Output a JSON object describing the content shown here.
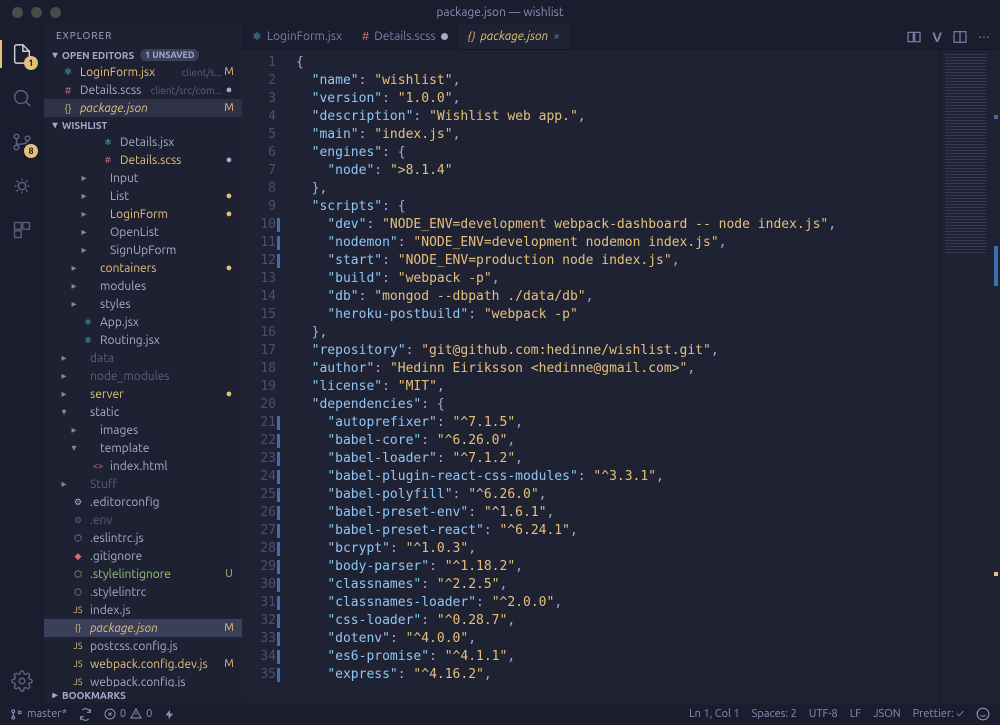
{
  "title": "package.json — wishlist",
  "explorerLabel": "EXPLORER",
  "openEditorsLabel": "OPEN EDITORS",
  "unsavedLabel": "1 UNSAVED",
  "projectLabel": "WISHLIST",
  "bookmarksLabel": "BOOKMARKS",
  "scmBadge": "8",
  "openEditors": [
    {
      "icon": "⚛",
      "iconColor": "#61dafb",
      "name": "LoginForm.jsx",
      "desc": "client/s...",
      "status": "M",
      "color": "yellow"
    },
    {
      "icon": "#",
      "iconColor": "#e06c75",
      "name": "Details.scss",
      "desc": "client/src/com...",
      "status": "●",
      "color": "",
      "dirty": true
    },
    {
      "icon": "{}",
      "iconColor": "#e5c07b",
      "name": "package.json",
      "desc": "",
      "status": "M",
      "color": "yellow",
      "active": true,
      "italic": true
    }
  ],
  "tree": [
    {
      "depth": 3,
      "chev": "",
      "icon": "⚛",
      "iconColor": "#61dafb",
      "label": "Details.jsx"
    },
    {
      "depth": 3,
      "chev": "",
      "icon": "#",
      "iconColor": "#e06c75",
      "label": "Details.scss",
      "status": "●",
      "statusClass": "dot",
      "color": "yellow"
    },
    {
      "depth": 2,
      "chev": "▸",
      "icon": "",
      "label": "Input"
    },
    {
      "depth": 2,
      "chev": "▸",
      "icon": "",
      "label": "List",
      "status": "●",
      "statusClass": "dot color-yellow"
    },
    {
      "depth": 2,
      "chev": "▸",
      "icon": "",
      "label": "LoginForm",
      "color": "yellow",
      "status": "●",
      "statusClass": "dot color-yellow"
    },
    {
      "depth": 2,
      "chev": "▸",
      "icon": "",
      "label": "OpenList"
    },
    {
      "depth": 2,
      "chev": "▸",
      "icon": "",
      "label": "SignUpForm"
    },
    {
      "depth": 1,
      "chev": "▸",
      "icon": "",
      "label": "containers",
      "color": "yellow",
      "status": "●",
      "statusClass": "dot color-yellow"
    },
    {
      "depth": 1,
      "chev": "▸",
      "icon": "",
      "label": "modules"
    },
    {
      "depth": 1,
      "chev": "▸",
      "icon": "",
      "label": "styles"
    },
    {
      "depth": 1,
      "chev": "",
      "icon": "⚛",
      "iconColor": "#61dafb",
      "label": "App.jsx"
    },
    {
      "depth": 1,
      "chev": "",
      "icon": "⚛",
      "iconColor": "#61dafb",
      "label": "Routing.jsx"
    },
    {
      "depth": 0,
      "chev": "▸",
      "icon": "",
      "label": "data",
      "color": "dim"
    },
    {
      "depth": 0,
      "chev": "▸",
      "icon": "",
      "label": "node_modules",
      "color": "dim"
    },
    {
      "depth": 0,
      "chev": "▸",
      "icon": "",
      "label": "server",
      "color": "yellow",
      "status": "●",
      "statusClass": "dot color-yellow"
    },
    {
      "depth": 0,
      "chev": "▾",
      "icon": "",
      "label": "static"
    },
    {
      "depth": 1,
      "chev": "▸",
      "icon": "",
      "label": "images"
    },
    {
      "depth": 1,
      "chev": "▾",
      "icon": "",
      "label": "template"
    },
    {
      "depth": 2,
      "chev": "",
      "icon": "<>",
      "iconColor": "#e06c75",
      "label": "index.html"
    },
    {
      "depth": 0,
      "chev": "▸",
      "icon": "",
      "label": "Stuff",
      "color": "dim"
    },
    {
      "depth": 0,
      "chev": "",
      "icon": "⚙",
      "iconColor": "#a6accd",
      "label": ".editorconfig"
    },
    {
      "depth": 0,
      "chev": "",
      "icon": "⚙",
      "iconColor": "#5a6080",
      "label": ".env",
      "color": "dim"
    },
    {
      "depth": 0,
      "chev": "",
      "icon": "⬡",
      "iconColor": "#c678dd",
      "label": ".eslintrc.js"
    },
    {
      "depth": 0,
      "chev": "",
      "icon": "◆",
      "iconColor": "#e06c75",
      "label": ".gitignore"
    },
    {
      "depth": 0,
      "chev": "",
      "icon": "⬡",
      "iconColor": "#98c379",
      "label": ".stylelintignore",
      "color": "green",
      "status": "U"
    },
    {
      "depth": 0,
      "chev": "",
      "icon": "⬡",
      "iconColor": "#56b6c2",
      "label": ".stylelintrc"
    },
    {
      "depth": 0,
      "chev": "",
      "icon": "JS",
      "iconColor": "#e5c07b",
      "label": "index.js"
    },
    {
      "depth": 0,
      "chev": "",
      "icon": "{}",
      "iconColor": "#e5c07b",
      "label": "package.json",
      "color": "yellow",
      "status": "M",
      "selected": true,
      "italic": true
    },
    {
      "depth": 0,
      "chev": "",
      "icon": "JS",
      "iconColor": "#e5c07b",
      "label": "postcss.config.js"
    },
    {
      "depth": 0,
      "chev": "",
      "icon": "JS",
      "iconColor": "#e5c07b",
      "label": "webpack.config.dev.js",
      "color": "yellow",
      "status": "M"
    },
    {
      "depth": 0,
      "chev": "",
      "icon": "JS",
      "iconColor": "#e5c07b",
      "label": "webpack.config.js"
    }
  ],
  "tabs": [
    {
      "icon": "⚛",
      "iconColor": "#61dafb",
      "label": "LoginForm.jsx",
      "dirty": false
    },
    {
      "icon": "#",
      "iconColor": "#e06c75",
      "label": "Details.scss",
      "dirty": true
    },
    {
      "icon": "{}",
      "iconColor": "#e5c07b",
      "label": "package.json",
      "active": true,
      "dirty": false
    }
  ],
  "tabActionV": "V",
  "code": [
    {
      "n": 1,
      "t": [
        [
          "punc",
          "{"
        ]
      ]
    },
    {
      "n": 2,
      "t": [
        [
          "punc",
          "  "
        ],
        [
          "key",
          "\"name\""
        ],
        [
          "op",
          ": "
        ],
        [
          "str",
          "\"wishlist\""
        ],
        [
          "punc",
          ","
        ]
      ]
    },
    {
      "n": 3,
      "t": [
        [
          "punc",
          "  "
        ],
        [
          "key",
          "\"version\""
        ],
        [
          "op",
          ": "
        ],
        [
          "str",
          "\"1.0.0\""
        ],
        [
          "punc",
          ","
        ]
      ]
    },
    {
      "n": 4,
      "t": [
        [
          "punc",
          "  "
        ],
        [
          "key",
          "\"description\""
        ],
        [
          "op",
          ": "
        ],
        [
          "str",
          "\"Wishlist web app.\""
        ],
        [
          "punc",
          ","
        ]
      ]
    },
    {
      "n": 5,
      "t": [
        [
          "punc",
          "  "
        ],
        [
          "key",
          "\"main\""
        ],
        [
          "op",
          ": "
        ],
        [
          "str",
          "\"index.js\""
        ],
        [
          "punc",
          ","
        ]
      ]
    },
    {
      "n": 6,
      "t": [
        [
          "punc",
          "  "
        ],
        [
          "key",
          "\"engines\""
        ],
        [
          "op",
          ": "
        ],
        [
          "punc",
          "{"
        ]
      ]
    },
    {
      "n": 7,
      "t": [
        [
          "punc",
          "    "
        ],
        [
          "key",
          "\"node\""
        ],
        [
          "op",
          ": "
        ],
        [
          "str",
          "\">8.1.4\""
        ]
      ]
    },
    {
      "n": 8,
      "t": [
        [
          "punc",
          "  },"
        ]
      ]
    },
    {
      "n": 9,
      "t": [
        [
          "punc",
          "  "
        ],
        [
          "key",
          "\"scripts\""
        ],
        [
          "op",
          ": "
        ],
        [
          "punc",
          "{"
        ]
      ]
    },
    {
      "n": 10,
      "mod": true,
      "t": [
        [
          "punc",
          "    "
        ],
        [
          "key",
          "\"dev\""
        ],
        [
          "op",
          ": "
        ],
        [
          "str",
          "\"NODE_ENV=development webpack-dashboard -- node index.js\""
        ],
        [
          "punc",
          ","
        ]
      ]
    },
    {
      "n": 11,
      "mod": true,
      "t": [
        [
          "punc",
          "    "
        ],
        [
          "key",
          "\"nodemon\""
        ],
        [
          "op",
          ": "
        ],
        [
          "str",
          "\"NODE_ENV=development nodemon index.js\""
        ],
        [
          "punc",
          ","
        ]
      ]
    },
    {
      "n": 12,
      "mod": true,
      "t": [
        [
          "punc",
          "    "
        ],
        [
          "key",
          "\"start\""
        ],
        [
          "op",
          ": "
        ],
        [
          "str",
          "\"NODE_ENV=production node index.js\""
        ],
        [
          "punc",
          ","
        ]
      ]
    },
    {
      "n": 13,
      "t": [
        [
          "punc",
          "    "
        ],
        [
          "key",
          "\"build\""
        ],
        [
          "op",
          ": "
        ],
        [
          "str",
          "\"webpack -p\""
        ],
        [
          "punc",
          ","
        ]
      ]
    },
    {
      "n": 14,
      "t": [
        [
          "punc",
          "    "
        ],
        [
          "key",
          "\"db\""
        ],
        [
          "op",
          ": "
        ],
        [
          "str",
          "\"mongod --dbpath ./data/db\""
        ],
        [
          "punc",
          ","
        ]
      ]
    },
    {
      "n": 15,
      "t": [
        [
          "punc",
          "    "
        ],
        [
          "key",
          "\"heroku-postbuild\""
        ],
        [
          "op",
          ": "
        ],
        [
          "str",
          "\"webpack -p\""
        ]
      ]
    },
    {
      "n": 16,
      "t": [
        [
          "punc",
          "  },"
        ]
      ]
    },
    {
      "n": 17,
      "t": [
        [
          "punc",
          "  "
        ],
        [
          "key",
          "\"repository\""
        ],
        [
          "op",
          ": "
        ],
        [
          "str",
          "\"git@github.com:hedinne/wishlist.git\""
        ],
        [
          "punc",
          ","
        ]
      ]
    },
    {
      "n": 18,
      "t": [
        [
          "punc",
          "  "
        ],
        [
          "key",
          "\"author\""
        ],
        [
          "op",
          ": "
        ],
        [
          "str",
          "\"Hedinn Eiriksson <hedinne@gmail.com>\""
        ],
        [
          "punc",
          ","
        ]
      ]
    },
    {
      "n": 19,
      "t": [
        [
          "punc",
          "  "
        ],
        [
          "key",
          "\"license\""
        ],
        [
          "op",
          ": "
        ],
        [
          "str",
          "\"MIT\""
        ],
        [
          "punc",
          ","
        ]
      ]
    },
    {
      "n": 20,
      "t": [
        [
          "punc",
          "  "
        ],
        [
          "key",
          "\"dependencies\""
        ],
        [
          "op",
          ": "
        ],
        [
          "punc",
          "{"
        ]
      ]
    },
    {
      "n": 21,
      "mod": true,
      "t": [
        [
          "punc",
          "    "
        ],
        [
          "key",
          "\"autoprefixer\""
        ],
        [
          "op",
          ": "
        ],
        [
          "str",
          "\"^7.1.5\""
        ],
        [
          "punc",
          ","
        ]
      ]
    },
    {
      "n": 22,
      "mod": true,
      "t": [
        [
          "punc",
          "    "
        ],
        [
          "key",
          "\"babel-core\""
        ],
        [
          "op",
          ": "
        ],
        [
          "str",
          "\"^6.26.0\""
        ],
        [
          "punc",
          ","
        ]
      ]
    },
    {
      "n": 23,
      "mod": true,
      "t": [
        [
          "punc",
          "    "
        ],
        [
          "key",
          "\"babel-loader\""
        ],
        [
          "op",
          ": "
        ],
        [
          "str",
          "\"^7.1.2\""
        ],
        [
          "punc",
          ","
        ]
      ]
    },
    {
      "n": 24,
      "mod": true,
      "t": [
        [
          "punc",
          "    "
        ],
        [
          "key",
          "\"babel-plugin-react-css-modules\""
        ],
        [
          "op",
          ": "
        ],
        [
          "str",
          "\"^3.3.1\""
        ],
        [
          "punc",
          ","
        ]
      ]
    },
    {
      "n": 25,
      "mod": true,
      "t": [
        [
          "punc",
          "    "
        ],
        [
          "key",
          "\"babel-polyfill\""
        ],
        [
          "op",
          ": "
        ],
        [
          "str",
          "\"^6.26.0\""
        ],
        [
          "punc",
          ","
        ]
      ]
    },
    {
      "n": 26,
      "mod": true,
      "t": [
        [
          "punc",
          "    "
        ],
        [
          "key",
          "\"babel-preset-env\""
        ],
        [
          "op",
          ": "
        ],
        [
          "str",
          "\"^1.6.1\""
        ],
        [
          "punc",
          ","
        ]
      ]
    },
    {
      "n": 27,
      "mod": true,
      "t": [
        [
          "punc",
          "    "
        ],
        [
          "key",
          "\"babel-preset-react\""
        ],
        [
          "op",
          ": "
        ],
        [
          "str",
          "\"^6.24.1\""
        ],
        [
          "punc",
          ","
        ]
      ]
    },
    {
      "n": 28,
      "mod": true,
      "t": [
        [
          "punc",
          "    "
        ],
        [
          "key",
          "\"bcrypt\""
        ],
        [
          "op",
          ": "
        ],
        [
          "str",
          "\"^1.0.3\""
        ],
        [
          "punc",
          ","
        ]
      ]
    },
    {
      "n": 29,
      "mod": true,
      "t": [
        [
          "punc",
          "    "
        ],
        [
          "key",
          "\"body-parser\""
        ],
        [
          "op",
          ": "
        ],
        [
          "str",
          "\"^1.18.2\""
        ],
        [
          "punc",
          ","
        ]
      ]
    },
    {
      "n": 30,
      "mod": true,
      "t": [
        [
          "punc",
          "    "
        ],
        [
          "key",
          "\"classnames\""
        ],
        [
          "op",
          ": "
        ],
        [
          "str",
          "\"^2.2.5\""
        ],
        [
          "punc",
          ","
        ]
      ]
    },
    {
      "n": 31,
      "mod": true,
      "t": [
        [
          "punc",
          "    "
        ],
        [
          "key",
          "\"classnames-loader\""
        ],
        [
          "op",
          ": "
        ],
        [
          "str",
          "\"^2.0.0\""
        ],
        [
          "punc",
          ","
        ]
      ]
    },
    {
      "n": 32,
      "mod": true,
      "t": [
        [
          "punc",
          "    "
        ],
        [
          "key",
          "\"css-loader\""
        ],
        [
          "op",
          ": "
        ],
        [
          "str",
          "\"^0.28.7\""
        ],
        [
          "punc",
          ","
        ]
      ]
    },
    {
      "n": 33,
      "mod": true,
      "t": [
        [
          "punc",
          "    "
        ],
        [
          "key",
          "\"dotenv\""
        ],
        [
          "op",
          ": "
        ],
        [
          "str",
          "\"^4.0.0\""
        ],
        [
          "punc",
          ","
        ]
      ]
    },
    {
      "n": 34,
      "mod": true,
      "t": [
        [
          "punc",
          "    "
        ],
        [
          "key",
          "\"es6-promise\""
        ],
        [
          "op",
          ": "
        ],
        [
          "str",
          "\"^4.1.1\""
        ],
        [
          "punc",
          ","
        ]
      ]
    },
    {
      "n": 35,
      "mod": true,
      "t": [
        [
          "punc",
          "    "
        ],
        [
          "key",
          "\"express\""
        ],
        [
          "op",
          ": "
        ],
        [
          "str",
          "\"^4.16.2\""
        ],
        [
          "punc",
          ","
        ]
      ]
    }
  ],
  "statusBar": {
    "branch": "master*",
    "errors": "0",
    "warnings": "0",
    "lncol": "Ln 1, Col 1",
    "spaces": "Spaces: 2",
    "encoding": "UTF-8",
    "eol": "LF",
    "language": "JSON",
    "prettier": "Prettier: ✓"
  }
}
